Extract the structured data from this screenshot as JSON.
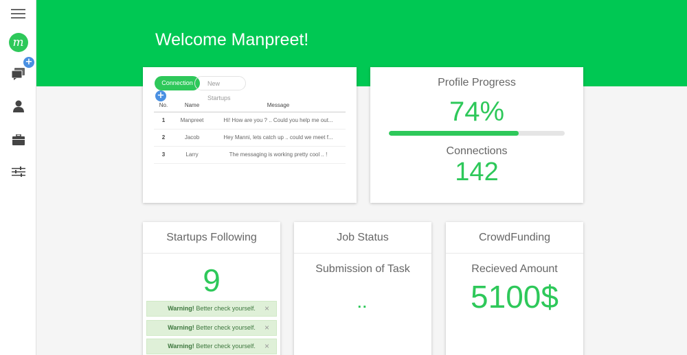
{
  "sidebar": {
    "logo_letter": "m",
    "badge": "+",
    "icons": [
      "menu-icon",
      "chat-icon",
      "user-icon",
      "briefcase-icon",
      "sliders-icon"
    ]
  },
  "header": {
    "welcome": "Welcome Manpreet!"
  },
  "messages": {
    "tabs": [
      "Connection",
      "New Startups"
    ],
    "badge": "+",
    "columns": [
      "No.",
      "Name",
      "Message"
    ],
    "rows": [
      {
        "no": "1",
        "name": "Manpreet",
        "message": "Hi! How are you ? .. Could you help me out..."
      },
      {
        "no": "2",
        "name": "Jacob",
        "message": "Hey Manni, lets catch up .. could we meet f..."
      },
      {
        "no": "3",
        "name": "Larry",
        "message": "The messaging is working pretty cool .. !"
      }
    ]
  },
  "profile": {
    "title": "Profile Progress",
    "percent_label": "74%",
    "percent": 74,
    "connections_label": "Connections",
    "connections": "142"
  },
  "startups": {
    "title": "Startups Following",
    "count": "9",
    "warnings": [
      {
        "strong": "Warning!",
        "text": " Better check yourself.",
        "close": "×"
      },
      {
        "strong": "Warning!",
        "text": " Better check yourself.",
        "close": "×"
      },
      {
        "strong": "Warning!",
        "text": " Better check yourself.",
        "close": "×"
      }
    ]
  },
  "jobs": {
    "title": "Job Status",
    "subtitle": "Submission of Task",
    "value": ".."
  },
  "crowd": {
    "title": "CrowdFunding",
    "subtitle": "Recieved Amount",
    "amount": "5100$"
  },
  "colors": {
    "accent": "#00c853",
    "green_text": "#2ec85a",
    "badge_blue": "#4a90e2",
    "warning_bg": "#dff0d8"
  }
}
